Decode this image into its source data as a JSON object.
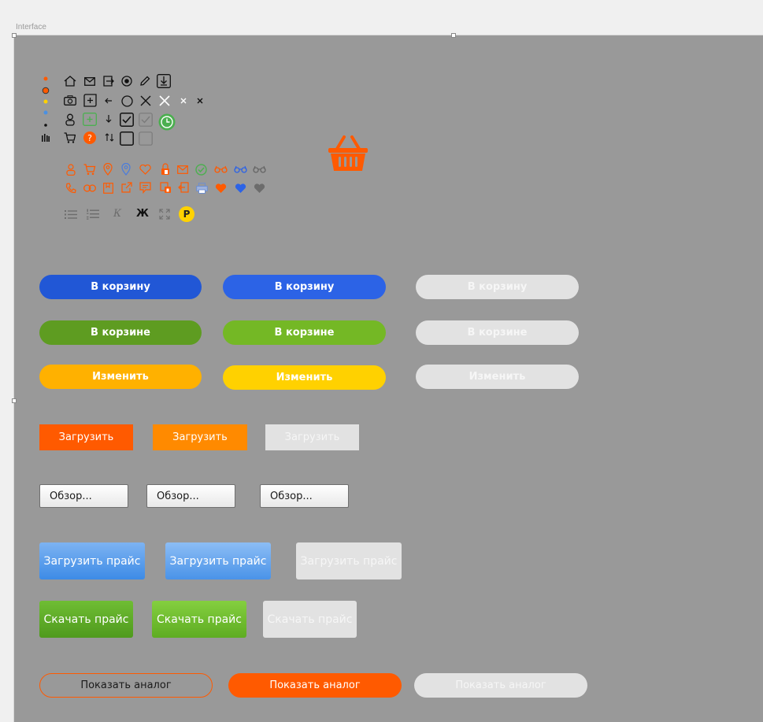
{
  "frame": {
    "label": "Interface"
  },
  "colors": {
    "orange": "#ff5a00",
    "blue_dark": "#2157d6",
    "blue": "#2c63e6",
    "green_dark": "#5e9c21",
    "green": "#74b825",
    "amber": "#ffb100",
    "yellow": "#ffd100",
    "disabled": "#e2e2e2",
    "disabled_text": "#f6f6f6",
    "artboard": "#999999"
  },
  "icons": {
    "row1": [
      "home-icon",
      "mail-icon",
      "login-icon",
      "radio-icon",
      "pencil-icon",
      "download-icon"
    ],
    "row2": [
      "camera-icon",
      "add-tab-icon",
      "arrow-left-icon",
      "circle-icon",
      "close-large-icon",
      "close-white-icon",
      "close-small-icon",
      "close-tiny-icon"
    ],
    "row3": [
      "user-icon",
      "plus-square-icon",
      "arrow-down-icon",
      "checkbox-checked-icon",
      "checkbox-checked-disabled-icon",
      "clock-icon"
    ],
    "row4": [
      "cart-icon",
      "help-icon",
      "sort-icon",
      "checkbox-empty-icon",
      "checkbox-empty-disabled-icon"
    ],
    "orange_row1": [
      "user-icon",
      "cart-icon",
      "location-icon",
      "location-blue-icon",
      "heart-icon",
      "lock-icon",
      "mail-icon",
      "check-circle-icon",
      "glasses-icon",
      "glasses-blue-icon",
      "glasses-gray-icon"
    ],
    "orange_row2": [
      "phone-icon",
      "link-icon",
      "bookmark-icon",
      "external-link-icon",
      "comment-icon",
      "lock-doc-icon",
      "exit-icon",
      "print-icon",
      "heart-filled-icon",
      "heart-blue-icon",
      "heart-gray-icon"
    ],
    "editor_row": [
      "bullet-list-icon",
      "numbered-list-icon",
      "italic-icon",
      "bold-icon",
      "fullscreen-icon",
      "ruble-icon"
    ],
    "basket": "basket-icon"
  },
  "editor": {
    "italic": "К",
    "bold": "Ж",
    "ruble": "Р"
  },
  "buttons": {
    "to_cart": "В корзину",
    "in_cart": "В корзине",
    "change": "Изменить",
    "upload": "Загрузить",
    "browse": "Обзор...",
    "upload_price": "Загрузить прайс",
    "download_price": "Скачать прайс",
    "show_analog": "Показать аналог"
  }
}
